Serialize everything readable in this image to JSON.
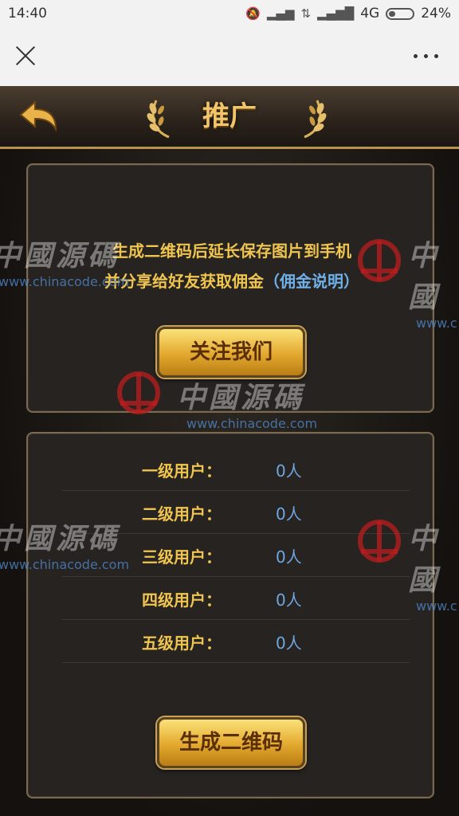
{
  "status_bar": {
    "time": "14:40",
    "network": "4G",
    "battery": "24%"
  },
  "game": {
    "title": "推广"
  },
  "promo_panel": {
    "line1": "生成二维码后延长保存图片到手机",
    "line2_prefix": "并分享给好友获取佣金",
    "link_text": "（佣金说明）",
    "follow_button": "关注我们"
  },
  "user_levels": [
    {
      "label": "一级用户：",
      "count": "0人"
    },
    {
      "label": "二级用户：",
      "count": "0人"
    },
    {
      "label": "三级用户：",
      "count": "0人"
    },
    {
      "label": "四级用户：",
      "count": "0人"
    },
    {
      "label": "五级用户：",
      "count": "0人"
    }
  ],
  "generate_button": "生成二维码",
  "watermark": {
    "chinese": "中國源碼",
    "chinese_partial": "國源碼",
    "chinese_first": "中",
    "chinese_first2": "中國",
    "url": "www.chinacode.com",
    "url_partial": "www.chinacode.com",
    "url_partial2": "www.c"
  },
  "colors": {
    "gold_text": "#f0c54f",
    "link_blue": "#6fb0e8",
    "value_blue": "#6fa7e0"
  }
}
